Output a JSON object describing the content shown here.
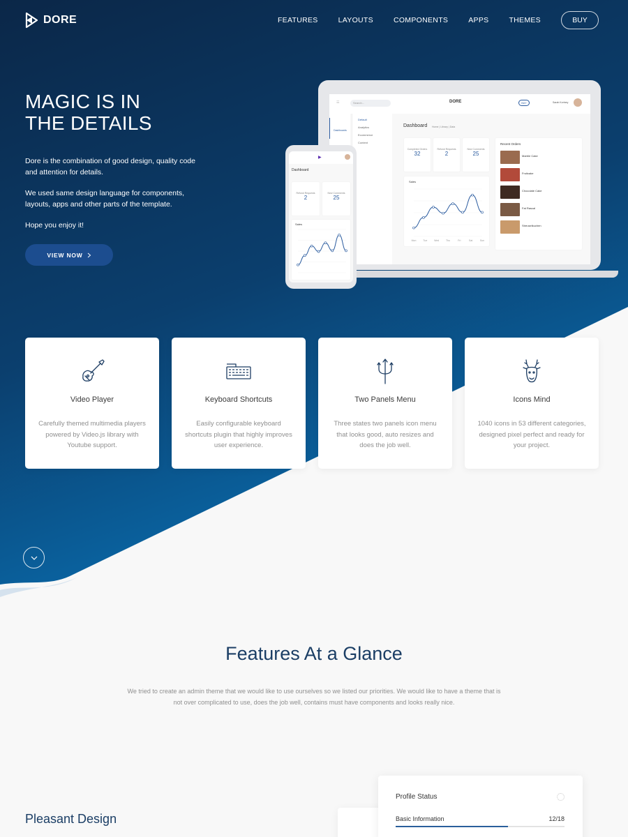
{
  "nav": {
    "brand": "DORE",
    "items": [
      "FEATURES",
      "LAYOUTS",
      "COMPONENTS",
      "APPS",
      "THEMES"
    ],
    "buy_label": "BUY"
  },
  "hero": {
    "title_line1": "MAGIC IS IN",
    "title_line2": "THE DETAILS",
    "p1": "Dore is the combination of good design, quality code and attention for details.",
    "p2": "We used same design language for components, layouts, apps and other parts of the template.",
    "p3": "Hope you enjoy it!",
    "cta_label": "VIEW NOW"
  },
  "mockup": {
    "search_placeholder": "Search...",
    "logo": "DORE",
    "buy": "BUY",
    "user": "Sarah Kortney",
    "side_item": "Dashboards",
    "sub_items": [
      "Default",
      "Analytics",
      "Ecommerce",
      "Content"
    ],
    "title": "Dashboard",
    "breadcrumb": "Home | Library | Data",
    "stats": [
      {
        "label": "Completed Orders",
        "value": "32"
      },
      {
        "label": "Refund Requests",
        "value": "2"
      },
      {
        "label": "New Comments",
        "value": "25"
      }
    ],
    "sales_label": "Sales",
    "sales_days": [
      "Mon",
      "Tue",
      "Wed",
      "Thu",
      "Fri",
      "Sat",
      "Sun"
    ],
    "recent_orders_title": "Recent Orders",
    "orders": [
      "Marble Cake",
      "Fruitcake",
      "Chocolate Cake",
      "Fat Rascal",
      "Streuselkuchen"
    ],
    "sales_values": [
      20,
      32,
      44,
      37,
      48,
      38,
      58,
      38
    ]
  },
  "phone": {
    "title": "Dashboard",
    "stats": [
      {
        "label": "Refund Requests",
        "value": "2"
      },
      {
        "label": "New Comments",
        "value": "25"
      }
    ],
    "sales_label": "Sales"
  },
  "features": [
    {
      "icon": "guitar-icon",
      "title": "Video Player",
      "desc": "Carefully themed multimedia players powered by Video.js library with Youtube support."
    },
    {
      "icon": "keyboard-icon",
      "title": "Keyboard Shortcuts",
      "desc": "Easily configurable keyboard shortcuts plugin that highly improves user experience."
    },
    {
      "icon": "trident-icon",
      "title": "Two Panels Menu",
      "desc": "Three states two panels icon menu that looks good, auto resizes and does the job well."
    },
    {
      "icon": "deer-icon",
      "title": "Icons Mind",
      "desc": "1040 icons in 53 different categories, designed pixel perfect and ready for your project."
    }
  ],
  "glance": {
    "title": "Features At a Glance",
    "desc": "We tried to create an admin theme that we would like to use ourselves so we listed our priorities. We would like to have a theme that is not over complicated to use, does the job well, contains must have components and looks really nice."
  },
  "pleasant": {
    "title": "Pleasant Design"
  },
  "profile": {
    "title": "Profile Status",
    "label": "Basic Information",
    "count": "12/18",
    "progress": 0.667
  },
  "colors": {
    "accent": "#2a5f9b",
    "hero_dark": "#0b2748",
    "hero_light": "#0b74b6",
    "heading": "#1b3e65"
  }
}
